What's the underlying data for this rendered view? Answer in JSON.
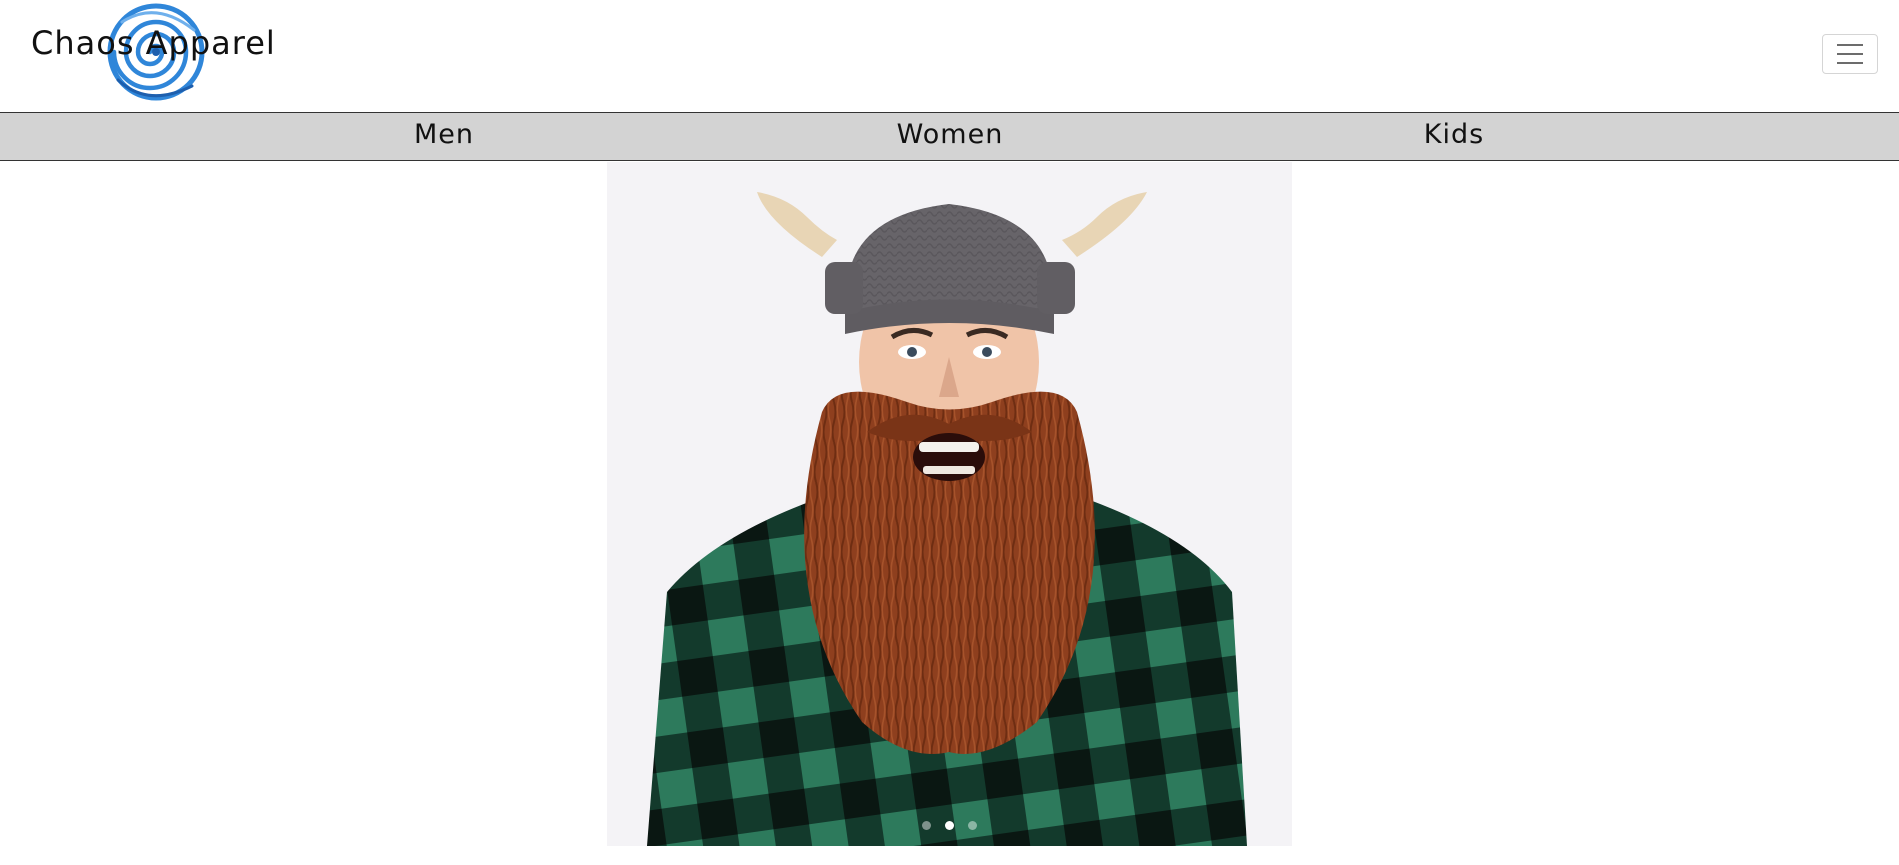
{
  "brand": {
    "name": "Chaos Apparel",
    "logo_icon": "spiral-logo-icon",
    "accent": "#2f86d9"
  },
  "header": {
    "menu_icon": "hamburger-menu-icon"
  },
  "nav": {
    "items": [
      {
        "label": "Men"
      },
      {
        "label": "Women"
      },
      {
        "label": "Kids"
      }
    ],
    "background": "#d3d3d3"
  },
  "carousel": {
    "slide_count": 3,
    "active_index": 1,
    "image_subject": "man in knitted viking hat with horns and long brown yarn beard, green plaid shirt"
  }
}
